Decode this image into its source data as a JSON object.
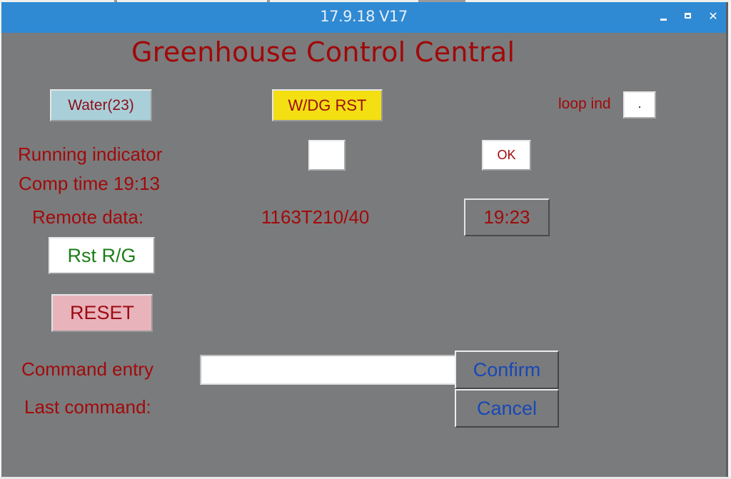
{
  "window": {
    "title": "17.9.18 V17",
    "controls": {
      "minimize": "minimize",
      "maximize": "maximize",
      "close": "✕"
    }
  },
  "app": {
    "heading": "Greenhouse Control Central",
    "buttons": {
      "water": "Water(23)",
      "wdg_rst": "W/DG RST",
      "ok": "OK",
      "rst_rg": "Rst R/G",
      "reset": "RESET",
      "confirm": "Confirm",
      "cancel": "Cancel"
    },
    "loop_indicator": {
      "label": "loop ind",
      "value": "."
    },
    "running_indicator": {
      "label": "Running indicator",
      "value": ""
    },
    "comp_time": "Comp time 19:13",
    "remote_data": {
      "label": "Remote data:",
      "value": "1163T210/40",
      "time": "19:23"
    },
    "command_entry": {
      "label": "Command entry",
      "value": "",
      "placeholder": ""
    },
    "last_command": {
      "label": "Last command:",
      "value": ""
    }
  },
  "colors": {
    "titlebar": "#2f8ad3",
    "window_bg": "#7a7b7d",
    "label_red": "#a20a0a",
    "water_button": "#a9cfd8",
    "wdg_button": "#f3df12",
    "reset_button": "#e8b3bb",
    "rst_text_green": "#1d7d1a",
    "confirm_text_blue": "#1748b6"
  }
}
